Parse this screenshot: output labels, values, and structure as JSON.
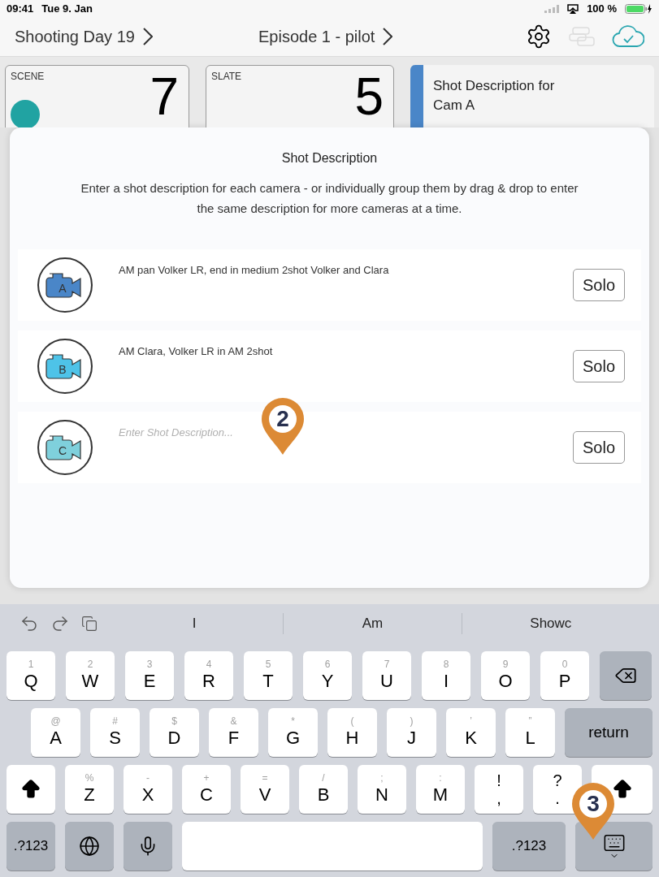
{
  "status_bar": {
    "time": "09:41",
    "date": "Tue 9. Jan",
    "battery": "100 %"
  },
  "nav": {
    "day": "Shooting Day 19",
    "episode": "Episode 1 - pilot"
  },
  "cards": {
    "scene": {
      "label": "SCENE",
      "value": "7"
    },
    "slate": {
      "label": "SLATE",
      "value": "5"
    },
    "description": "Shot Description for Cam A"
  },
  "modal": {
    "title": "Shot Description",
    "text": "Enter a shot description for each camera - or individually group them by drag & drop to enter the same description for more cameras at a time.",
    "cameras": [
      {
        "letter": "A",
        "description": "AM pan Volker LR, end in medium 2shot Volker and Clara",
        "color": "#4a86c8",
        "button": "Solo"
      },
      {
        "letter": "B",
        "description": "AM Clara, Volker LR in AM 2shot",
        "color": "#4ec3e8",
        "button": "Solo"
      },
      {
        "letter": "C",
        "placeholder": "Enter Shot Description...",
        "color": "#7fd0dc",
        "button": "Solo"
      }
    ]
  },
  "keyboard": {
    "suggestions": [
      "I",
      "Am",
      "Showc"
    ],
    "rows": [
      [
        {
          "kind": "letter",
          "hint": "1",
          "label": "Q"
        },
        {
          "kind": "letter",
          "hint": "2",
          "label": "W"
        },
        {
          "kind": "letter",
          "hint": "3",
          "label": "E"
        },
        {
          "kind": "letter",
          "hint": "4",
          "label": "R"
        },
        {
          "kind": "letter",
          "hint": "5",
          "label": "T"
        },
        {
          "kind": "letter",
          "hint": "6",
          "label": "Y"
        },
        {
          "kind": "letter",
          "hint": "7",
          "label": "U"
        },
        {
          "kind": "letter",
          "hint": "8",
          "label": "I"
        },
        {
          "kind": "letter",
          "hint": "9",
          "label": "O"
        },
        {
          "kind": "letter",
          "hint": "0",
          "label": "P"
        },
        {
          "kind": "backspace"
        }
      ],
      [
        {
          "kind": "letter",
          "hint": "@",
          "label": "A"
        },
        {
          "kind": "letter",
          "hint": "#",
          "label": "S"
        },
        {
          "kind": "letter",
          "hint": "$",
          "label": "D"
        },
        {
          "kind": "letter",
          "hint": "&",
          "label": "F"
        },
        {
          "kind": "letter",
          "hint": "*",
          "label": "G"
        },
        {
          "kind": "letter",
          "hint": "(",
          "label": "H"
        },
        {
          "kind": "letter",
          "hint": ")",
          "label": "J"
        },
        {
          "kind": "letter",
          "hint": "’",
          "label": "K"
        },
        {
          "kind": "letter",
          "hint": "”",
          "label": "L"
        },
        {
          "kind": "return",
          "label": "return"
        }
      ],
      [
        {
          "kind": "shift"
        },
        {
          "kind": "letter",
          "hint": "%",
          "label": "Z"
        },
        {
          "kind": "letter",
          "hint": "-",
          "label": "X"
        },
        {
          "kind": "letter",
          "hint": "+",
          "label": "C"
        },
        {
          "kind": "letter",
          "hint": "=",
          "label": "V"
        },
        {
          "kind": "letter",
          "hint": "/",
          "label": "B"
        },
        {
          "kind": "letter",
          "hint": ";",
          "label": "N"
        },
        {
          "kind": "letter",
          "hint": ":",
          "label": "M"
        },
        {
          "kind": "punct",
          "label": "!",
          "hint": ","
        },
        {
          "kind": "punct",
          "label": "?",
          "hint": "."
        },
        {
          "kind": "shift"
        }
      ],
      [
        {
          "kind": "mode",
          "label": ".?123"
        },
        {
          "kind": "globe"
        },
        {
          "kind": "mic"
        },
        {
          "kind": "space"
        },
        {
          "kind": "mode",
          "label": ".?123"
        },
        {
          "kind": "dismiss"
        }
      ]
    ]
  },
  "annotations": [
    {
      "label": "2"
    },
    {
      "label": "3"
    }
  ]
}
